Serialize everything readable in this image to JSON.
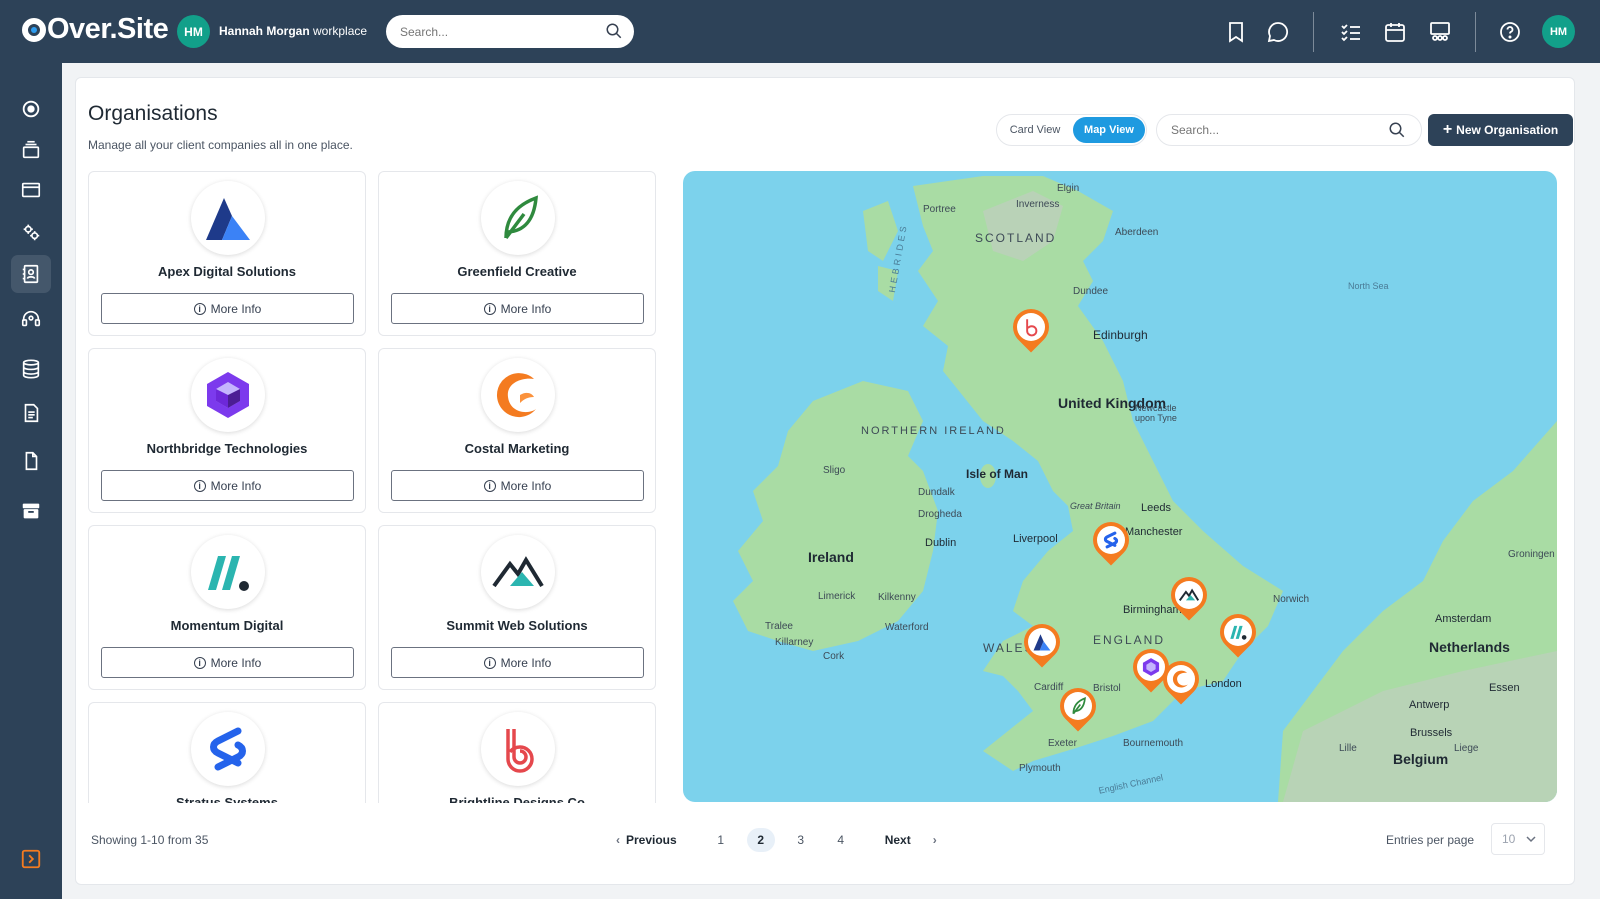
{
  "app": {
    "logo": "Over.Site",
    "workspace_initials": "HM",
    "workspace_name": "Hannah Morgan",
    "workspace_suffix": "workplace",
    "search_placeholder": "Search...",
    "user_initials": "HM"
  },
  "header": {
    "icons": [
      "bookmark-icon",
      "chat-icon",
      "checklist-icon",
      "calendar-icon",
      "team-icon",
      "help-icon"
    ]
  },
  "sidebar": {
    "items": [
      {
        "icon": "dashboard-icon",
        "active": false
      },
      {
        "icon": "projects-icon",
        "active": false
      },
      {
        "icon": "browser-icon",
        "active": false
      },
      {
        "icon": "settings-icon",
        "active": false
      },
      {
        "icon": "contacts-icon",
        "active": true
      },
      {
        "icon": "support-icon",
        "active": false
      },
      {
        "icon": "database-icon",
        "active": false
      },
      {
        "icon": "documents-icon",
        "active": false
      },
      {
        "icon": "file-icon",
        "active": false
      },
      {
        "icon": "archive-icon",
        "active": false
      }
    ],
    "collapse_icon": "collapse-icon"
  },
  "page": {
    "title": "Organisations",
    "subtitle": "Manage all your client companies all in one place.",
    "card_view_label": "Card View",
    "map_view_label": "Map View",
    "search_placeholder": "Search...",
    "new_button_label": "New Organisation",
    "more_info_label": "More Info"
  },
  "organisations": [
    {
      "name": "Apex Digital Solutions",
      "logo": "apex-logo"
    },
    {
      "name": "Greenfield Creative",
      "logo": "greenfield-logo"
    },
    {
      "name": "Northbridge Technologies",
      "logo": "northbridge-logo"
    },
    {
      "name": "Costal Marketing",
      "logo": "costal-logo"
    },
    {
      "name": "Momentum Digital",
      "logo": "momentum-logo"
    },
    {
      "name": "Summit Web Solutions",
      "logo": "summit-logo"
    },
    {
      "name": "Stratus Systems",
      "logo": "stratus-logo"
    },
    {
      "name": "Brightline Designs Co",
      "logo": "brightline-logo"
    }
  ],
  "map": {
    "labels": {
      "scotland": "SCOTLAND",
      "united_kingdom": "United Kingdom",
      "northern_ireland": "NORTHERN IRELAND",
      "isle_of_man": "Isle of Man",
      "ireland": "Ireland",
      "england": "ENGLAND",
      "wales": "WALES",
      "netherlands": "Netherlands",
      "belgium": "Belgium",
      "hebrides": "HEBRIDES",
      "north_sea": "North Sea",
      "english_channel": "English Channel",
      "great_britain": "Great Britain"
    },
    "cities": [
      "Elgin",
      "Portree",
      "Inverness",
      "Aberdeen",
      "Dundee",
      "Edinburgh",
      "Newcastle upon Tyne",
      "Sligo",
      "Dundalk",
      "Drogheda",
      "Dublin",
      "Liverpool",
      "Leeds",
      "Manchester",
      "Birmingham",
      "Norwich",
      "Limerick",
      "Kilkenny",
      "Waterford",
      "Tralee",
      "Killarney",
      "Cork",
      "Cardiff",
      "Bristol",
      "London",
      "Exeter",
      "Bournemouth",
      "Plymouth",
      "Amsterdam",
      "Antwerp",
      "Brussels",
      "Liege",
      "Essen",
      "Groningen",
      "Lille"
    ]
  },
  "pagination": {
    "showing": "Showing 1-10 from 35",
    "previous": "Previous",
    "next": "Next",
    "pages": [
      "1",
      "2",
      "3",
      "4"
    ],
    "current": "2",
    "entries_label": "Entries per page",
    "entries_value": "10"
  },
  "colors": {
    "nav_bg": "#2d4258",
    "accent_blue": "#1e9ae0",
    "pin_orange": "#f47b20",
    "teal_avatar": "#12a08a"
  }
}
